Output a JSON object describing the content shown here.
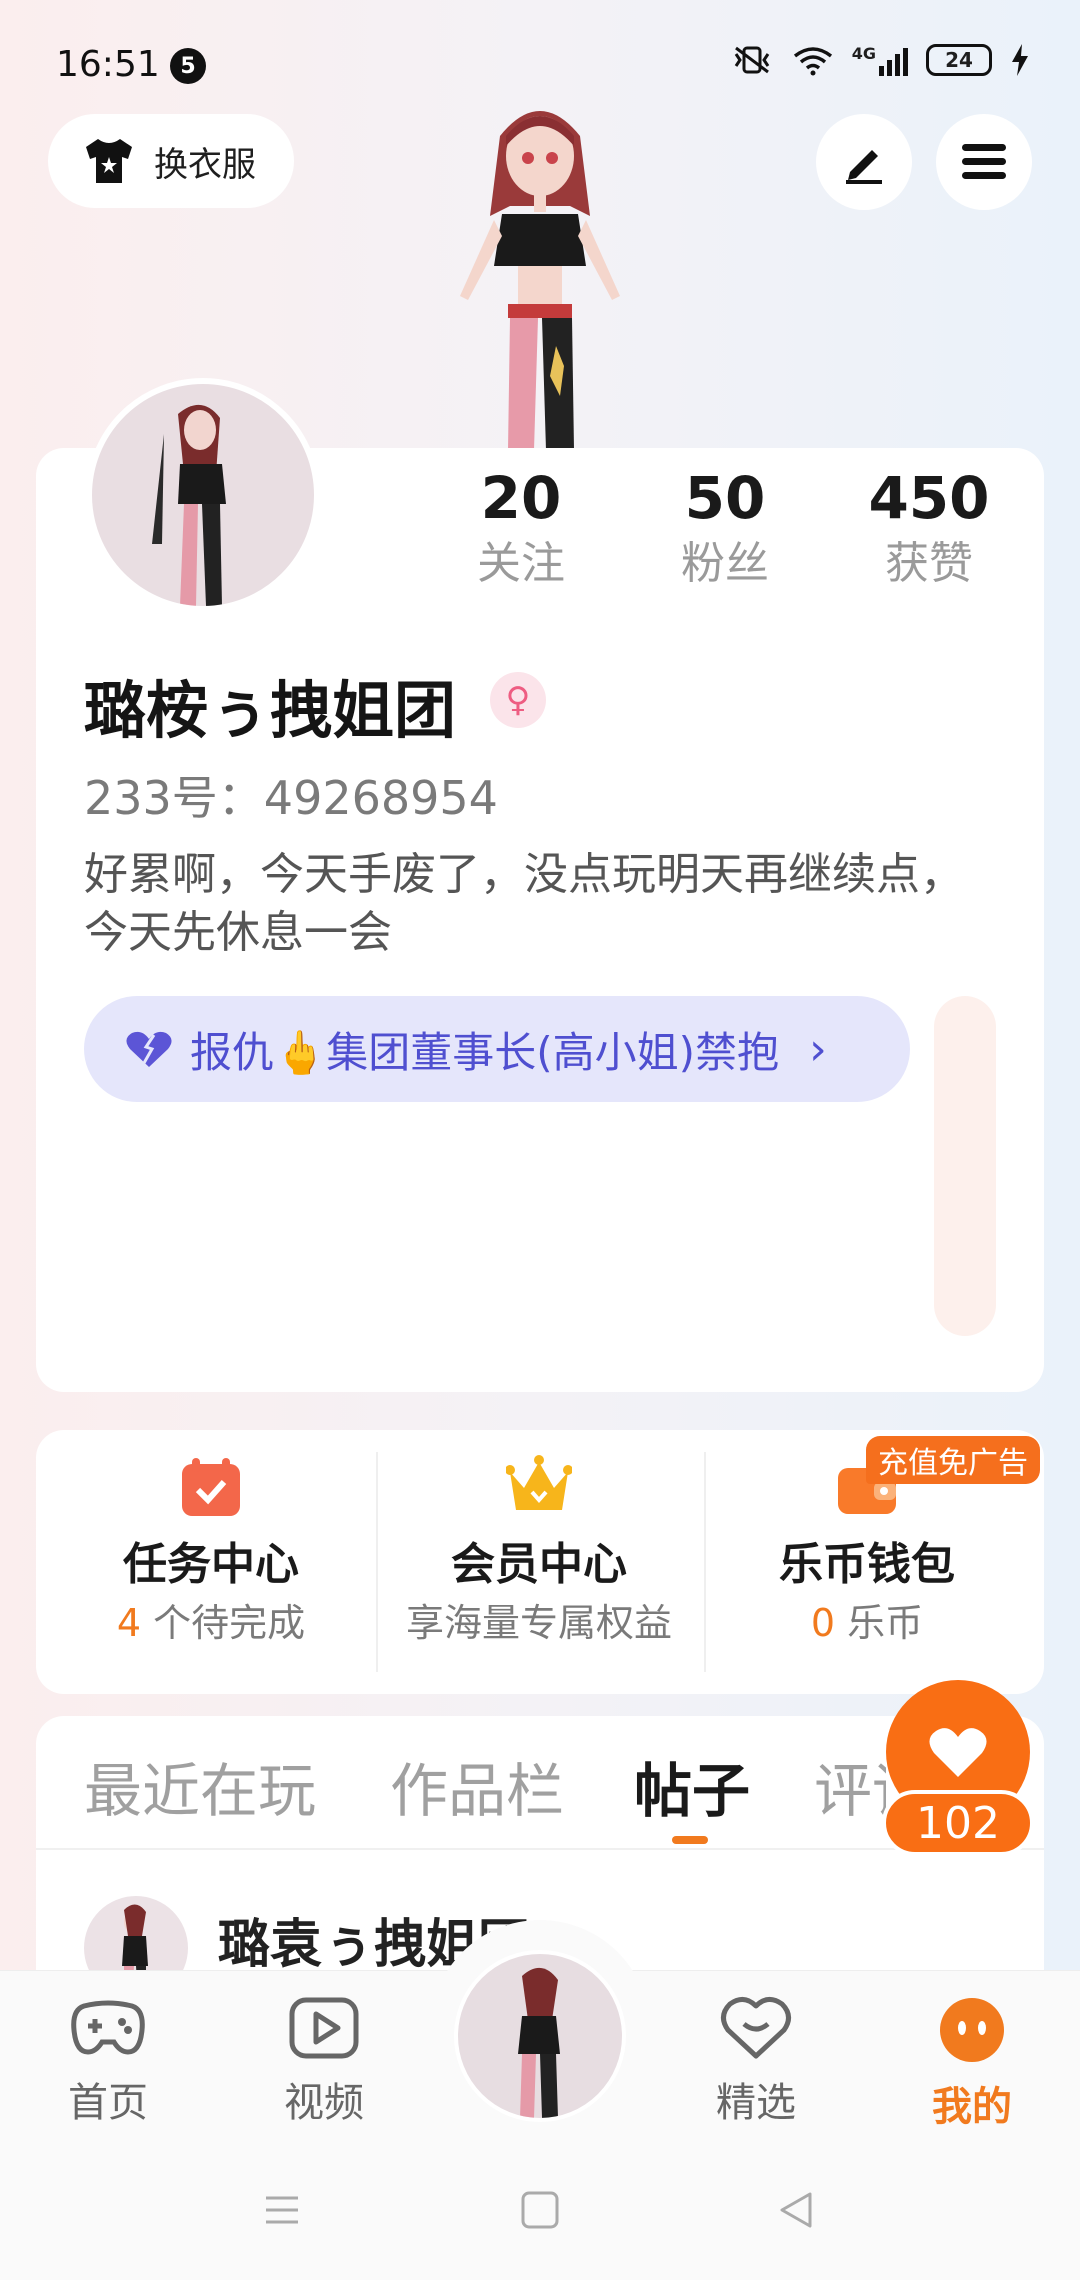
{
  "status_bar": {
    "time": "16:51",
    "notification_count": "5",
    "network": "4G",
    "battery": "24"
  },
  "top_bar": {
    "dress_button_label": "换衣服"
  },
  "stats": [
    {
      "value": "20",
      "label": "关注"
    },
    {
      "value": "50",
      "label": "粉丝"
    },
    {
      "value": "450",
      "label": "获赞"
    }
  ],
  "profile": {
    "username": "璐桉ぅ拽姐团",
    "gender_symbol": "♀",
    "uid": "233号：49268954",
    "bio": "好累啊，今天手废了，没点玩明天再继续点，今天先休息一会",
    "title_prefix": "报仇🖕集团董事长(高小姐)禁抱",
    "title_chevron": "›"
  },
  "services": [
    {
      "name": "任务中心",
      "sub_highlight": "4",
      "sub_text": " 个待完成"
    },
    {
      "name": "会员中心",
      "sub_highlight": "",
      "sub_text": "享海量专属权益"
    },
    {
      "name": "乐币钱包",
      "sub_highlight": "0",
      "sub_text": " 乐币"
    }
  ],
  "promo_tag": "充值免广告",
  "tabs": [
    "最近在玩",
    "作品栏",
    "帖子",
    "评论"
  ],
  "active_tab": "帖子",
  "post": {
    "author": "璐袁ぅ拽姐团"
  },
  "like_count": "102",
  "bottom_nav": [
    {
      "label": "首页"
    },
    {
      "label": "视频"
    },
    {
      "label": "精选"
    },
    {
      "label": "我的"
    }
  ],
  "colors": {
    "accent": "#f17a1e",
    "title_purple": "#4f4fd0",
    "pill_bg": "#e5e6fb"
  }
}
